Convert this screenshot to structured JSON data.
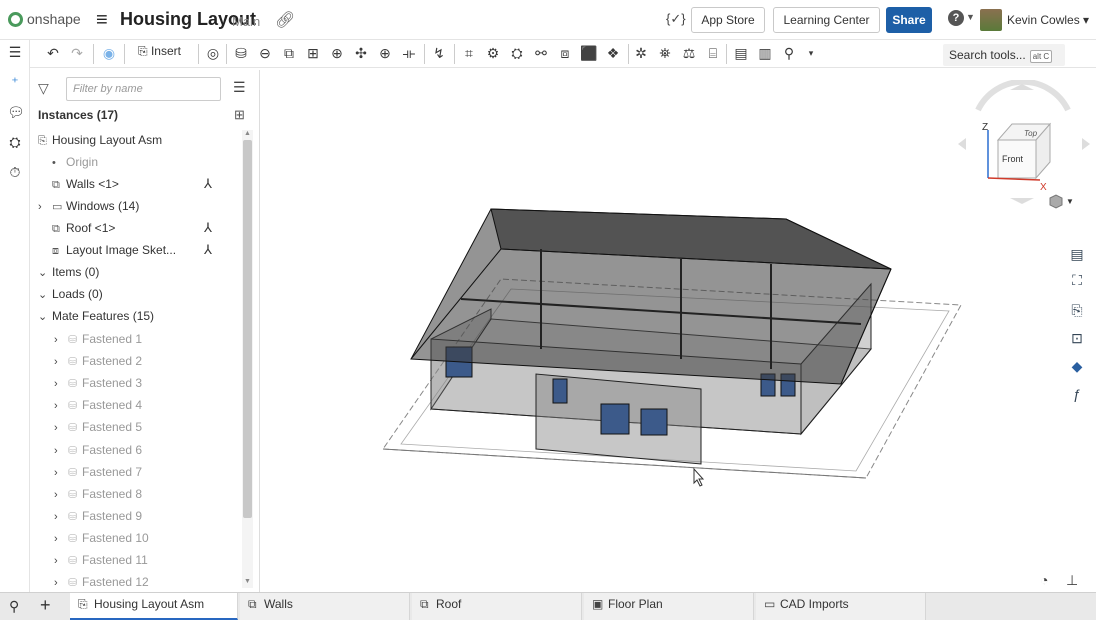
{
  "app": {
    "name": "onshape"
  },
  "document": {
    "title": "Housing Layout",
    "branch": "Main"
  },
  "topbar": {
    "variables_icon": "{✓}",
    "app_store": "App Store",
    "learning_center": "Learning Center",
    "share": "Share",
    "user": "Kevin Cowles ▾"
  },
  "toolbar": {
    "insert_label": "Insert",
    "search_placeholder": "Search tools...",
    "search_shortcut": "alt C"
  },
  "panel": {
    "filter_placeholder": "Filter by name",
    "instances_header": "Instances (17)",
    "tree": [
      {
        "label": "Housing Layout Asm",
        "icon": "assembly-icon",
        "caret": "",
        "indent": 0,
        "dim": false,
        "mate": false
      },
      {
        "label": "Origin",
        "icon": "origin-icon",
        "caret": "",
        "indent": 1,
        "dim": true,
        "mate": false
      },
      {
        "label": "Walls <1>",
        "icon": "part-studio-icon",
        "caret": "",
        "indent": 1,
        "dim": false,
        "mate": true
      },
      {
        "label": "Windows (14)",
        "icon": "folder-icon",
        "caret": "›",
        "indent": 0,
        "dim": false,
        "mate": false
      },
      {
        "label": "Roof <1>",
        "icon": "part-studio-icon",
        "caret": "",
        "indent": 1,
        "dim": false,
        "mate": true
      },
      {
        "label": "Layout Image Sket...",
        "icon": "sketch-icon",
        "caret": "",
        "indent": 1,
        "dim": false,
        "mate": true
      }
    ],
    "sections": [
      {
        "label": "Items (0)"
      },
      {
        "label": "Loads (0)"
      },
      {
        "label": "Mate Features (15)"
      }
    ],
    "mate_features": [
      "Fastened 1",
      "Fastened 2",
      "Fastened 3",
      "Fastened 4",
      "Fastened 5",
      "Fastened 6",
      "Fastened 7",
      "Fastened 8",
      "Fastened 9",
      "Fastened 10",
      "Fastened 11",
      "Fastened 12"
    ]
  },
  "viewcube": {
    "top": "Top",
    "front": "Front",
    "axis_z": "Z",
    "axis_x": "X"
  },
  "tabs": [
    {
      "label": "Housing Layout Asm",
      "icon": "assembly-icon",
      "active": true
    },
    {
      "label": "Walls",
      "icon": "part-studio-icon",
      "active": false
    },
    {
      "label": "Roof",
      "icon": "part-studio-icon",
      "active": false
    },
    {
      "label": "Floor Plan",
      "icon": "image-icon",
      "active": false
    },
    {
      "label": "CAD Imports",
      "icon": "folder-icon",
      "active": false
    }
  ]
}
